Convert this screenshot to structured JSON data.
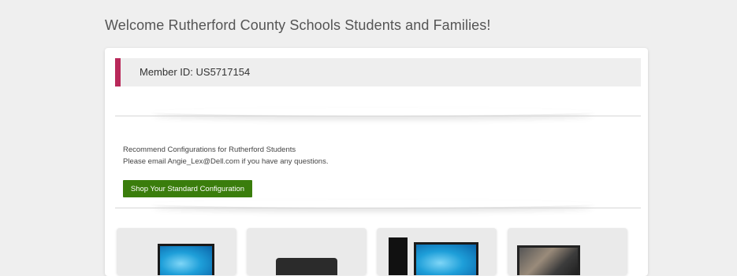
{
  "header": {
    "welcome_title": "Welcome Rutherford County Schools Students and Families!"
  },
  "member": {
    "id_label": "Member ID: US5717154",
    "accent_color": "#b9295a"
  },
  "recommendations": {
    "line1": "Recommend Configurations for Rutherford Students",
    "line2": "Please email Angie_Lex@Dell.com if you have any questions.",
    "button_label": "Shop Your Standard Configuration",
    "button_color": "#3a7d0c"
  },
  "products": [
    {
      "icon": "laptop-image"
    },
    {
      "icon": "laptop-closed-image"
    },
    {
      "icon": "desktop-tower-monitor-image"
    },
    {
      "icon": "monitor-photo-image"
    }
  ]
}
